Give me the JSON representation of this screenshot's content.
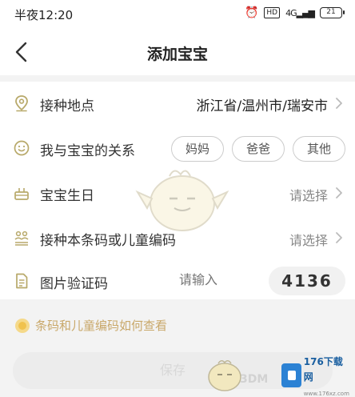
{
  "status_bar": {
    "time": "半夜12:20",
    "signal_label": "4G",
    "hd_label": "HD",
    "battery": "21"
  },
  "header": {
    "title": "添加宝宝"
  },
  "form": {
    "location": {
      "label": "接种地点",
      "value": "浙江省/温州市/瑞安市"
    },
    "relation": {
      "label": "我与宝宝的关系",
      "options": [
        "妈妈",
        "爸爸",
        "其他"
      ]
    },
    "birthday": {
      "label": "宝宝生日",
      "placeholder": "请选择"
    },
    "barcode": {
      "label": "接种本条码或儿童编码",
      "placeholder": "请选择"
    },
    "captcha": {
      "label": "图片验证码",
      "placeholder": "请输入",
      "code": "4136"
    }
  },
  "help": {
    "text": "条码和儿童编码如何查看"
  },
  "submit": {
    "label": "保存"
  },
  "watermark": {
    "site_text": "3DM",
    "logo_text": "176下载网",
    "logo_sub": "www.176xz.com"
  },
  "colors": {
    "accent_gold": "#c9a86a",
    "icon_color": "#b8a96a"
  }
}
